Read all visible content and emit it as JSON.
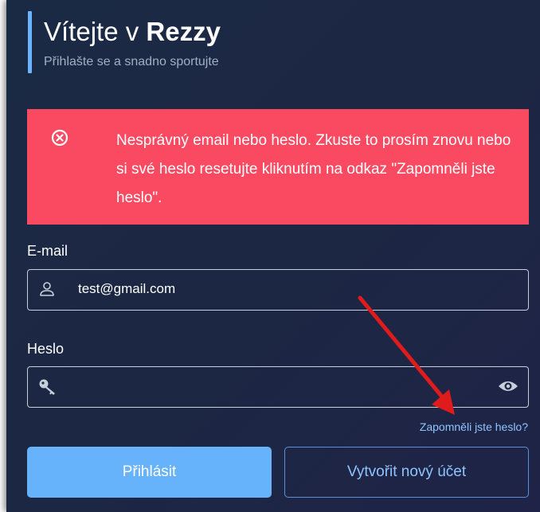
{
  "header": {
    "title_prefix": "Vítejte v",
    "title_brand": "Rezzy",
    "subtitle": "Přihlašte se a snadno sportujte"
  },
  "alert": {
    "icon": "circle-x-icon",
    "message": "Nesprávný email nebo heslo. Zkuste to prosím znovu nebo si své heslo resetujte kliknutím na odkaz \"Zapomněli jste heslo\"."
  },
  "form": {
    "email_label": "E-mail",
    "email_value": "test@gmail.com",
    "email_icon": "user-icon",
    "password_label": "Heslo",
    "password_value": "",
    "password_icon": "key-icon",
    "show_password_icon": "eye-icon",
    "forgot_link": "Zapomněli jste heslo?"
  },
  "buttons": {
    "login": "Přihlásit",
    "register": "Vytvořit nový účet"
  },
  "colors": {
    "background": "#1b2a44",
    "accent": "#6bb4ff",
    "alert": "#fa4a61",
    "primary_button": "#67b3fb",
    "link": "#8fc4ff",
    "annotation_arrow": "#e01b1b"
  }
}
